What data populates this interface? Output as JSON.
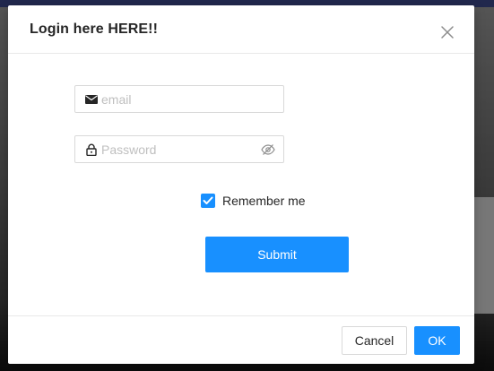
{
  "modal": {
    "title": "Login here HERE!!",
    "close_icon": "close-icon"
  },
  "form": {
    "email": {
      "value": "",
      "placeholder": "email",
      "icon": "mail-icon"
    },
    "password": {
      "value": "",
      "placeholder": "Password",
      "icon": "lock-icon",
      "toggle_icon": "eye-invisible-icon"
    },
    "remember": {
      "label": "Remember me",
      "checked": true
    },
    "submit_label": "Submit"
  },
  "footer": {
    "cancel_label": "Cancel",
    "ok_label": "OK"
  },
  "colors": {
    "primary": "#1890ff",
    "border": "#d9d9d9",
    "text": "#262626",
    "placeholder": "#bfbfbf"
  }
}
